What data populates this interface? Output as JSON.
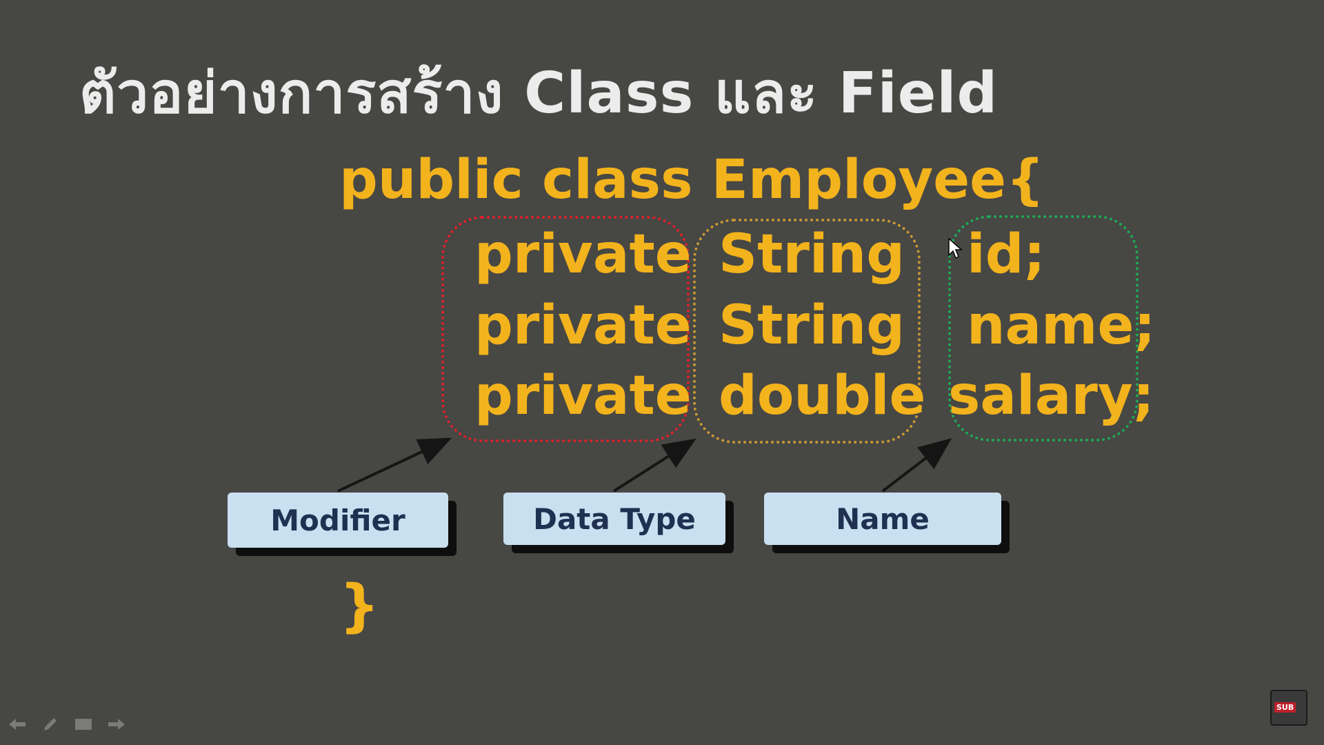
{
  "slide": {
    "title": "ตัวอย่างการสร้าง Class และ Field",
    "code_header": "public class Employee{",
    "closing_brace": "}",
    "fields": [
      {
        "modifier": "private",
        "type": "String",
        "name": "id;"
      },
      {
        "modifier": "private",
        "type": "String",
        "name": "name;"
      },
      {
        "modifier": "private",
        "type": "double",
        "name": "salary;"
      }
    ],
    "labels": {
      "modifier": "Modifier",
      "data_type": "Data Type",
      "name": "Name"
    }
  },
  "colors": {
    "background": "#474744",
    "code_text": "#f3b31c",
    "title_text": "#ececec",
    "modifier_outline": "#e0202a",
    "type_outline": "#c99a32",
    "name_outline": "#1daa55",
    "label_box": "#c8e0f0",
    "label_text": "#1f3151"
  },
  "badge": {
    "text": "SUB"
  },
  "icons": [
    "back-arrow-icon",
    "pen-icon",
    "screen-icon",
    "forward-arrow-icon",
    "subtitles-icon",
    "mouse-cursor-icon"
  ]
}
